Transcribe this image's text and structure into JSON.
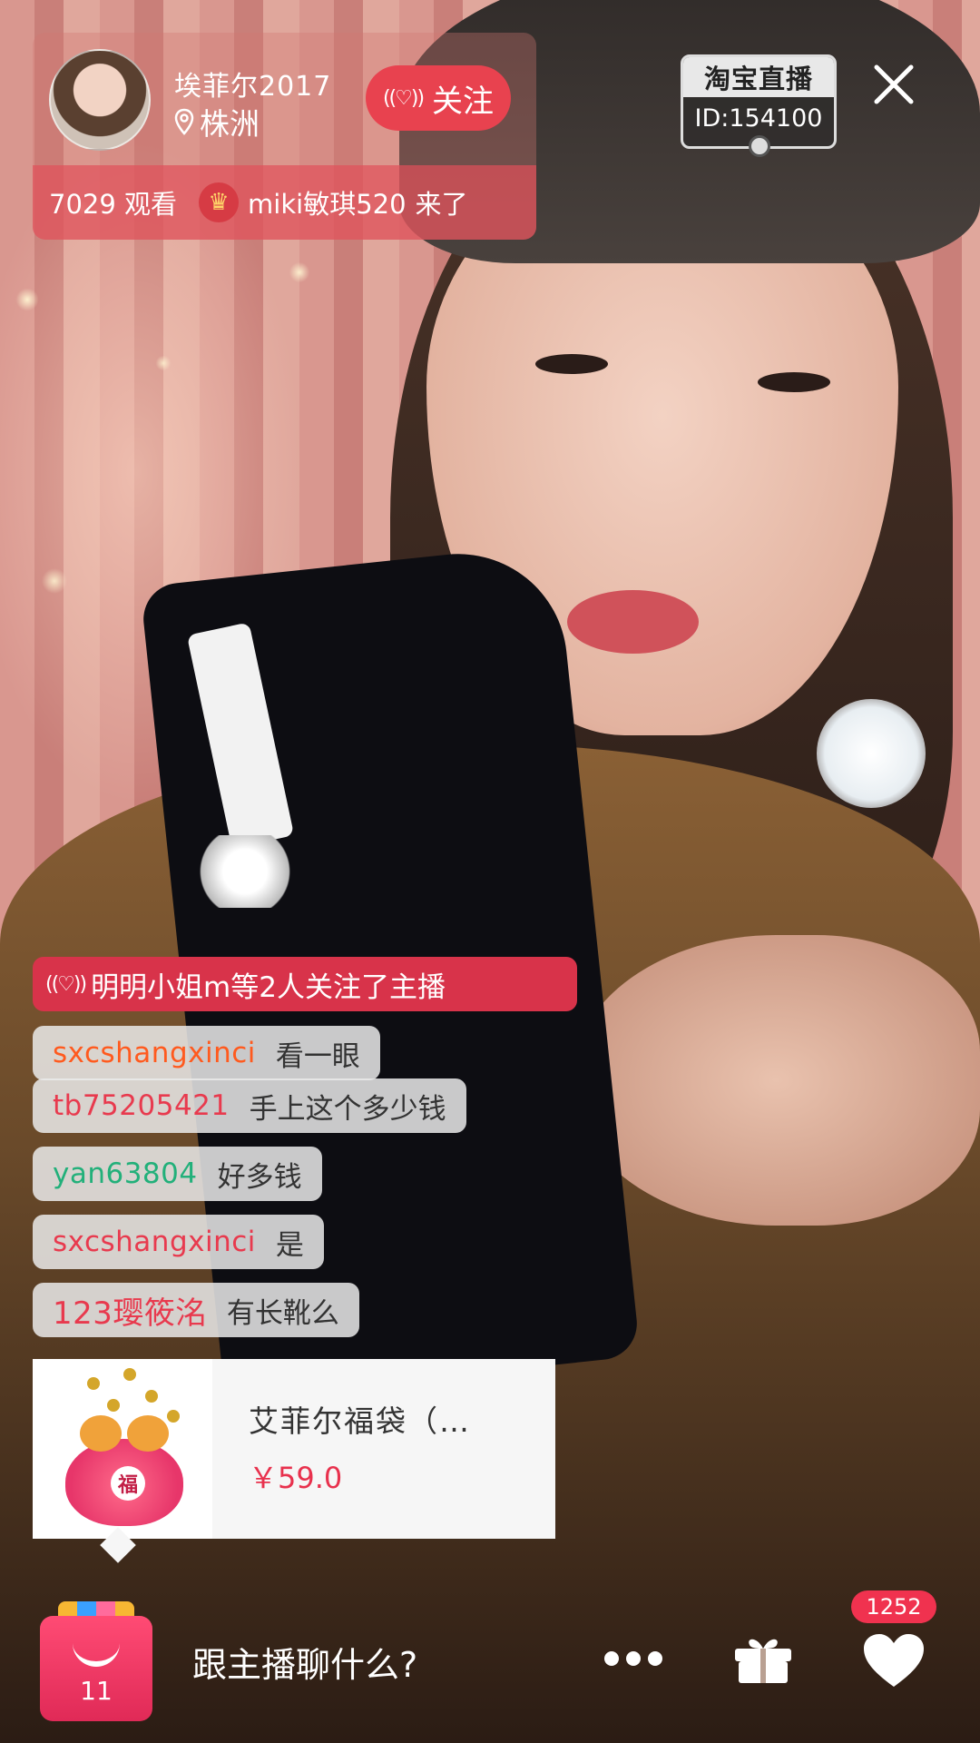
{
  "host": {
    "name": "埃菲尔2017",
    "location": "株洲",
    "follow_label": "关注",
    "viewers": "7029 观看",
    "arrival_user": "miki敏琪520",
    "arrival_text": "来了"
  },
  "badge": {
    "logo": "淘宝直播",
    "id": "ID:154100"
  },
  "follow_banner": "明明小姐m等2人关注了主播",
  "chat": [
    {
      "user": "sxcshangxinci",
      "text": "看一眼",
      "color": "#ff5a1e"
    },
    {
      "user": "tb75205421",
      "text": "手上这个多少钱",
      "color": "#e83a4e"
    },
    {
      "user": "yan63804",
      "text": "好多钱",
      "color": "#22b07a"
    },
    {
      "user": "sxcshangxinci",
      "text": "是",
      "color": "#e83a4e"
    },
    {
      "user": "123璎筱洺",
      "text": "有长靴么",
      "color": "#e83a4e"
    }
  ],
  "product": {
    "title": "艾菲尔福袋（…",
    "price": "￥59.0",
    "image_char": "福"
  },
  "bottom": {
    "bag_count": "11",
    "chat_placeholder": "跟主播聊什么?",
    "like_count": "1252"
  },
  "colors": {
    "accent": "#e8424f",
    "price": "#e8314d"
  }
}
